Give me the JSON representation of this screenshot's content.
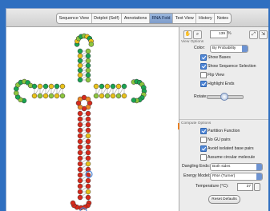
{
  "tabs": [
    "Sequence View",
    "Dotplot (Self)",
    "Annotations",
    "RNA Fold",
    "Text View",
    "History",
    "Notes"
  ],
  "active_tab": 3,
  "toolbar": {
    "zoom_value": "139",
    "zoom_unit": "%"
  },
  "view_options": {
    "title": "View Options",
    "color_label": "Color:",
    "color_value": "By Probability",
    "show_bases": "Show Bases",
    "show_sequence_selection": "Show Sequence Selection",
    "flip_view": "Flip View",
    "highlight_ends": "Highlight Ends",
    "rotate_label": "Rotate:"
  },
  "compute_options": {
    "title": "Compute Options",
    "partition_function": "Partition Function",
    "no_gu_pairs": "No GU pairs",
    "avoid_isolated": "Avoid isolated base pairs",
    "assume_circular": "Assume circular molecule",
    "dangling_label": "Dangling Ends:",
    "dangling_value": "Both sides",
    "energy_label": "Energy Model:",
    "energy_value": "RNA (Turner)",
    "temperature_label": "Temperature (°C):",
    "temperature_value": "37",
    "reset_label": "Reset Defaults"
  },
  "colors": {
    "base_low": "#d92a1c",
    "base_mid": "#e9c21a",
    "base_high": "#1aa552",
    "accent_blue": "#4f86d6"
  }
}
